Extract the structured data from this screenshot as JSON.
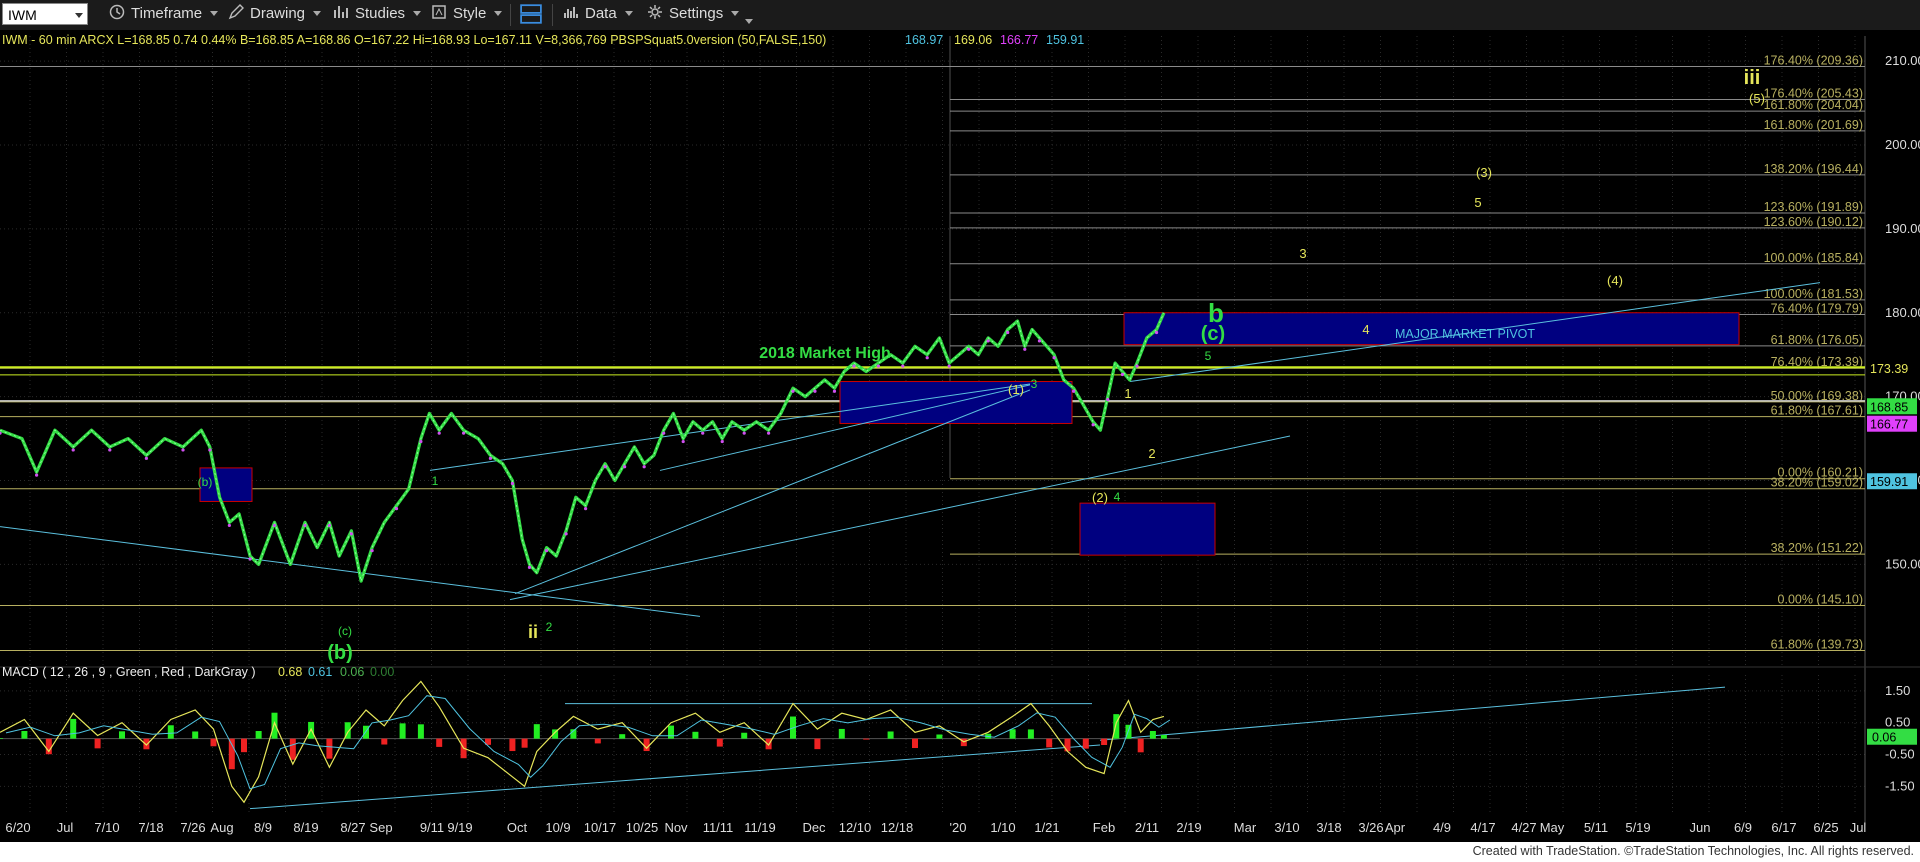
{
  "toolbar": {
    "symbol": "IWM",
    "timeframe": "Timeframe",
    "drawing": "Drawing",
    "studies": "Studies",
    "style": "Style",
    "data": "Data",
    "settings": "Settings"
  },
  "header": {
    "info": "IWM - 60 min  ARCX  L=168.85  0.74  0.44%  B=168.85  A=168.86  O=167.22  Hi=168.93  Lo=167.11  V=8,366,769  PBSPSquat5.0version (50,FALSE,150)",
    "values": [
      "168.97",
      "169.06",
      "166.77",
      "159.91"
    ],
    "value_colors": [
      "#4fc3e0",
      "#e6e65a",
      "#e040fb",
      "#4fc3e0"
    ]
  },
  "macd_header": {
    "text": "MACD ( 12 , 26 , 9 , Green , Red , DarkGray )",
    "values": [
      "0.68",
      "0.61",
      "0.06",
      "0.00"
    ],
    "value_colors": [
      "#e6e65a",
      "#4fc3e0",
      "#4caf50",
      "#2e7d32"
    ]
  },
  "footer": "Created with TradeStation. ©TradeStation Technologies, Inc. All rights reserved.",
  "colors": {
    "background": "#000000",
    "price": "#33dd44",
    "fib": "#b8b060",
    "trend": "#5bc0de",
    "box": "#000080",
    "box_edge": "#cc0000",
    "green_label": "#33dd44",
    "yellow_label": "#e6e65a"
  },
  "chart_data": {
    "type": "line",
    "price_axis": {
      "ticks": [
        150,
        160,
        170,
        180,
        190,
        200,
        210
      ],
      "ylim": [
        138,
        213
      ]
    },
    "macd_axis": {
      "ticks": [
        1.5,
        0.5,
        -0.5,
        -1.5
      ],
      "ylim": [
        -2.4,
        2.0
      ]
    },
    "x_ticks": [
      "6/20",
      "Jul",
      "7/10",
      "7/18",
      "7/26",
      "Aug",
      "8/9",
      "8/19",
      "8/27",
      "Sep",
      "9/11",
      "9/19",
      "Oct",
      "10/9",
      "10/17",
      "10/25",
      "Nov",
      "11/11",
      "11/19",
      "Dec",
      "12/10",
      "12/18",
      "'20",
      "1/10",
      "1/21",
      "Feb",
      "2/11",
      "2/19",
      "Mar",
      "3/10",
      "3/18",
      "3/26",
      "Apr",
      "4/9",
      "4/17",
      "4/27",
      "May",
      "5/11",
      "5/19",
      "Jun",
      "6/9",
      "6/17",
      "6/25",
      "Jul"
    ],
    "price_series": [
      [
        0,
        166
      ],
      [
        18,
        165
      ],
      [
        30,
        161
      ],
      [
        45,
        166
      ],
      [
        60,
        164
      ],
      [
        75,
        166
      ],
      [
        90,
        164
      ],
      [
        105,
        165
      ],
      [
        120,
        163
      ],
      [
        135,
        165
      ],
      [
        150,
        164
      ],
      [
        165,
        166
      ],
      [
        172,
        164
      ],
      [
        180,
        158
      ],
      [
        188,
        155
      ],
      [
        196,
        156
      ],
      [
        205,
        151
      ],
      [
        212,
        150
      ],
      [
        225,
        155
      ],
      [
        238,
        150
      ],
      [
        250,
        155
      ],
      [
        260,
        152
      ],
      [
        270,
        155
      ],
      [
        278,
        151
      ],
      [
        288,
        154
      ],
      [
        296,
        148
      ],
      [
        305,
        152
      ],
      [
        315,
        155
      ],
      [
        325,
        157
      ],
      [
        335,
        159
      ],
      [
        345,
        165
      ],
      [
        352,
        168
      ],
      [
        360,
        166
      ],
      [
        370,
        168
      ],
      [
        380,
        166
      ],
      [
        392,
        165
      ],
      [
        402,
        163
      ],
      [
        412,
        162
      ],
      [
        420,
        160
      ],
      [
        428,
        153
      ],
      [
        434,
        150
      ],
      [
        440,
        149
      ],
      [
        448,
        152
      ],
      [
        456,
        151
      ],
      [
        464,
        154
      ],
      [
        472,
        158
      ],
      [
        480,
        157
      ],
      [
        488,
        160
      ],
      [
        496,
        162
      ],
      [
        504,
        160
      ],
      [
        512,
        162
      ],
      [
        520,
        164
      ],
      [
        528,
        162
      ],
      [
        536,
        163
      ],
      [
        544,
        166
      ],
      [
        552,
        168
      ],
      [
        560,
        165
      ],
      [
        568,
        167
      ],
      [
        576,
        166
      ],
      [
        584,
        167
      ],
      [
        592,
        165
      ],
      [
        600,
        167
      ],
      [
        610,
        166
      ],
      [
        620,
        167
      ],
      [
        630,
        166
      ],
      [
        640,
        168
      ],
      [
        650,
        171
      ],
      [
        660,
        170
      ],
      [
        668,
        171
      ],
      [
        676,
        172
      ],
      [
        684,
        171
      ],
      [
        692,
        173
      ],
      [
        700,
        174
      ],
      [
        710,
        173
      ],
      [
        720,
        174
      ],
      [
        730,
        175
      ],
      [
        740,
        174
      ],
      [
        750,
        176
      ],
      [
        760,
        175
      ],
      [
        770,
        177
      ],
      [
        778,
        174
      ],
      [
        786,
        175
      ],
      [
        794,
        176
      ],
      [
        802,
        175
      ],
      [
        810,
        177
      ],
      [
        818,
        176
      ],
      [
        826,
        178
      ],
      [
        834,
        179
      ],
      [
        840,
        176
      ],
      [
        846,
        178
      ],
      [
        852,
        177
      ],
      [
        858,
        176
      ],
      [
        864,
        175
      ],
      [
        872,
        172
      ],
      [
        880,
        171
      ],
      [
        888,
        169
      ],
      [
        896,
        167
      ],
      [
        902,
        166
      ],
      [
        908,
        170
      ],
      [
        914,
        174
      ],
      [
        920,
        173
      ],
      [
        926,
        172
      ],
      [
        932,
        174
      ],
      [
        940,
        177
      ],
      [
        948,
        178
      ],
      [
        954,
        180
      ]
    ],
    "price_bar_index": "x is bar index (0 = 6/20)",
    "horizontal_levels": [
      {
        "price": 176.4,
        "label": "176.40% (209.36)"
      },
      {
        "price": 176.4,
        "label": "176.40% (205.43)",
        "y_price": 205.43
      },
      {
        "price": 161.8,
        "label": "161.80% (204.04)",
        "y_price": 204.04
      },
      {
        "price": 161.8,
        "label": "161.80% (201.69)",
        "y_price": 201.69
      },
      {
        "price": 138.2,
        "label": "138.20% (196.44)",
        "y_price": 196.44
      },
      {
        "price": 123.6,
        "label": "123.60% (191.89)",
        "y_price": 191.89
      },
      {
        "price": 123.6,
        "label": "123.60% (190.12)",
        "y_price": 190.12
      },
      {
        "price": 100.0,
        "label": "100.00% (185.84)",
        "y_price": 185.84
      },
      {
        "price": 100.0,
        "label": "100.00% (181.53)",
        "y_price": 181.53
      },
      {
        "price": 76.4,
        "label": "76.40% (179.79)",
        "y_price": 179.79
      },
      {
        "price": 61.8,
        "label": "61.80% (176.05)",
        "y_price": 176.05
      },
      {
        "price": 76.4,
        "label": "76.40% (173.39)",
        "y_price": 173.39
      },
      {
        "price": 50.0,
        "label": "50.00% (169.38)",
        "y_price": 169.38
      },
      {
        "price": 61.8,
        "label": "61.80% (167.61)",
        "y_price": 167.61
      },
      {
        "price": 0.0,
        "label": "0.00% (160.21)",
        "y_price": 160.21
      },
      {
        "price": 38.2,
        "label": "38.20% (159.02)",
        "y_price": 159.02
      },
      {
        "price": 38.2,
        "label": "38.20% (151.22)",
        "y_price": 151.22
      },
      {
        "price": 0.0,
        "label": "0.00% (145.10)",
        "y_price": 145.1
      },
      {
        "price": 61.8,
        "label": "61.80% (139.73)",
        "y_price": 139.73
      }
    ],
    "price_tags": [
      {
        "text": "173.39",
        "y_price": 173.39,
        "bg": "#000",
        "fg": "#e6e65a"
      },
      {
        "text": "168.85",
        "y_price": 168.85,
        "bg": "#33dd44",
        "fg": "#000"
      },
      {
        "text": "166.77",
        "y_price": 166.77,
        "bg": "#e040fb",
        "fg": "#000"
      },
      {
        "text": "159.91",
        "y_price": 159.91,
        "bg": "#4fc3e0",
        "fg": "#000"
      }
    ],
    "annotations": [
      {
        "text": "2018 Market High",
        "color": "#33dd44"
      },
      {
        "text": "MAJOR MARKET PIVOT",
        "color": "#4fc3e0"
      },
      {
        "text": "b",
        "color": "#33dd44"
      },
      {
        "text": "(c)",
        "color": "#33dd44"
      },
      {
        "text": "iii",
        "color": "#e6e65a"
      },
      {
        "text": "ii",
        "color": "#e6e65a"
      },
      {
        "text": "(b)",
        "color": "#33dd44"
      },
      {
        "text": "(c)",
        "color": "#33dd44"
      },
      {
        "text": "(b)",
        "color": "#33dd44"
      },
      {
        "text": "(1)",
        "color": "#e6e65a"
      },
      {
        "text": "(2)",
        "color": "#e6e65a"
      },
      {
        "text": "(3)",
        "color": "#e6e65a"
      },
      {
        "text": "(4)",
        "color": "#e6e65a"
      },
      {
        "text": "(5)",
        "color": "#e6e65a"
      },
      {
        "text": "1",
        "color": "#e6e65a"
      },
      {
        "text": "2",
        "color": "#e6e65a"
      },
      {
        "text": "3",
        "color": "#e6e65a"
      },
      {
        "text": "4",
        "color": "#e6e65a"
      },
      {
        "text": "5",
        "color": "#e6e65a"
      },
      {
        "text": "1",
        "color": "#33dd44"
      },
      {
        "text": "2",
        "color": "#33dd44"
      },
      {
        "text": "3",
        "color": "#33dd44"
      },
      {
        "text": "4",
        "color": "#33dd44"
      },
      {
        "text": "5",
        "color": "#33dd44"
      }
    ],
    "macd_series": [
      [
        0,
        0.2
      ],
      [
        20,
        0.6
      ],
      [
        40,
        -0.4
      ],
      [
        60,
        0.8
      ],
      [
        80,
        0.1
      ],
      [
        100,
        0.5
      ],
      [
        120,
        -0.2
      ],
      [
        140,
        0.6
      ],
      [
        160,
        0.9
      ],
      [
        175,
        0.3
      ],
      [
        190,
        -1.5
      ],
      [
        200,
        -2.0
      ],
      [
        212,
        -1.2
      ],
      [
        225,
        0.5
      ],
      [
        240,
        -0.8
      ],
      [
        255,
        0.3
      ],
      [
        270,
        -0.9
      ],
      [
        285,
        0.2
      ],
      [
        300,
        0.9
      ],
      [
        315,
        0.4
      ],
      [
        330,
        1.2
      ],
      [
        345,
        1.8
      ],
      [
        360,
        1.0
      ],
      [
        380,
        -0.3
      ],
      [
        400,
        -0.6
      ],
      [
        420,
        -1.2
      ],
      [
        430,
        -1.5
      ],
      [
        440,
        -0.4
      ],
      [
        455,
        0.2
      ],
      [
        470,
        0.7
      ],
      [
        490,
        0.3
      ],
      [
        510,
        0.5
      ],
      [
        530,
        -0.3
      ],
      [
        550,
        0.5
      ],
      [
        570,
        0.8
      ],
      [
        590,
        0.2
      ],
      [
        610,
        0.5
      ],
      [
        630,
        -0.2
      ],
      [
        650,
        1.1
      ],
      [
        670,
        0.3
      ],
      [
        690,
        0.8
      ],
      [
        710,
        0.6
      ],
      [
        730,
        0.9
      ],
      [
        750,
        0.2
      ],
      [
        770,
        0.4
      ],
      [
        790,
        -0.1
      ],
      [
        810,
        0.2
      ],
      [
        830,
        0.7
      ],
      [
        845,
        1.1
      ],
      [
        860,
        0.4
      ],
      [
        875,
        -0.4
      ],
      [
        890,
        -0.9
      ],
      [
        905,
        -1.1
      ],
      [
        915,
        0.5
      ],
      [
        925,
        1.2
      ],
      [
        935,
        0.2
      ],
      [
        945,
        0.6
      ],
      [
        954,
        0.7
      ]
    ]
  }
}
